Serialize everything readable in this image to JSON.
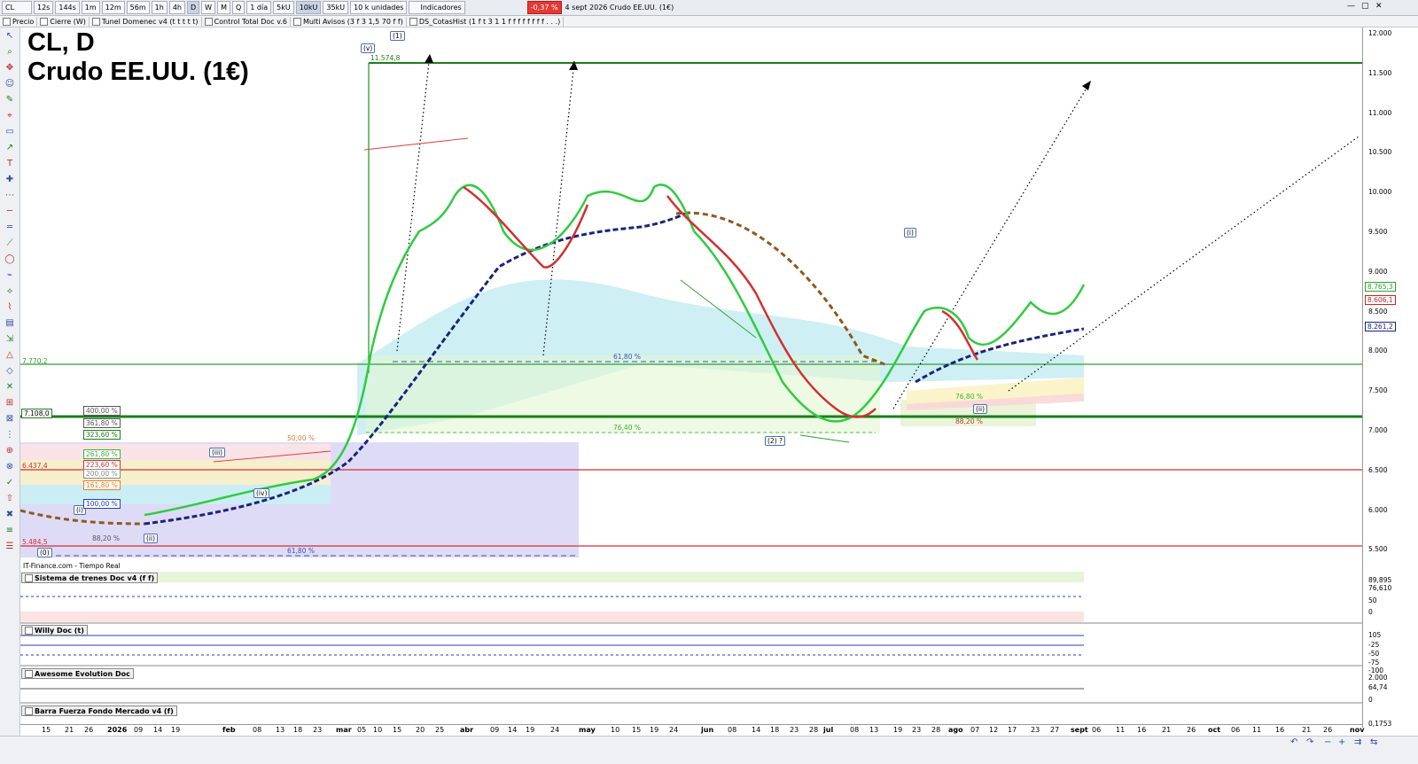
{
  "toolbar": {
    "symbol": "CL",
    "timeframes": [
      "12s",
      "144s",
      "1m",
      "12m",
      "56m",
      "1h",
      "4h",
      "D",
      "W",
      "M",
      "Q"
    ],
    "period": "1 día",
    "ticks": [
      "5kU",
      "10kU",
      "35kU"
    ],
    "units": "10 k unidades",
    "indicators": "Indicadores",
    "change": "-0,37 %",
    "status": "4 sept 2026  Crudo EE.UU. (1€)"
  },
  "toolbar2": {
    "items": [
      "Precio",
      "Cierre (W)",
      "Tunel Domenec v4 (t t t t t)",
      "Control Total Doc v.6",
      "Multi Avisos (3 f 3 1,5 70 f f)",
      "DS_CotasHist (1 f t 3 1 1 f f f f f f f f . . .)"
    ]
  },
  "chart": {
    "title_line1": "CL, D",
    "title_line2": "Crudo EE.UU. (1€)",
    "footer_label": "IT-Finance.com - Tiempo Real",
    "labels": {
      "top_price": "11.574,8",
      "fib_6180_a": "61,80 %",
      "fib_7640": "76,40 %",
      "fib_6180_b": "61,80 %",
      "fib_7680": "76,80 %",
      "fib_8820_a": "88,20 %",
      "fib_8820_b": "88,20 %",
      "fib_5000": "50,00 %",
      "level_7770": "7.770,2",
      "level_7108": "7.108,0",
      "level_6437": "6.437,4",
      "level_5484": "5.484,5",
      "wave_v": "(v)",
      "wave_1": "(1)",
      "wave_iii": "(iii)",
      "wave_iv": "(iv)",
      "wave_i": "(i)",
      "wave_ii": "(ii)",
      "wave_0": "(0)",
      "wave_2": "(2) ?",
      "wave_i2": "(i)",
      "wave_ii2": "(ii)"
    },
    "fib_boxes": [
      {
        "text": "400,00 %",
        "color": "#555555"
      },
      {
        "text": "361,80 %",
        "color": "#555555"
      },
      {
        "text": "323,60 %",
        "color": "#1b7e1b"
      },
      {
        "text": "261,80 %",
        "color": "#3cae3c"
      },
      {
        "text": "223,60 %",
        "color": "#d32f2f"
      },
      {
        "text": "200,00 %",
        "color": "#888888"
      },
      {
        "text": "161,80 %",
        "color": "#e67e22"
      },
      {
        "text": "100,00 %",
        "color": "#1f3fbf"
      }
    ]
  },
  "price_axis": {
    "ticks": [
      "12.000",
      "11.500",
      "11.000",
      "10.500",
      "10.000",
      "9.500",
      "9.000",
      "8.500",
      "8.000",
      "7.500",
      "7.000",
      "6.500",
      "6.000",
      "5.500"
    ],
    "badges": [
      {
        "text": "8.765,3",
        "color": "#2e9e2e"
      },
      {
        "text": "8.606,1",
        "color": "#c62828"
      },
      {
        "text": "8.261,2",
        "color": "#1a237e"
      }
    ]
  },
  "panels": [
    {
      "name": "Sistema de trenes Doc v4 (f f)",
      "right": [
        "89,895",
        "76,610",
        "50",
        "0"
      ]
    },
    {
      "name": "Willy Doc (t)",
      "right": [
        "105",
        "-25",
        "-50",
        "-75",
        "-100"
      ]
    },
    {
      "name": "Awesome Evolution Doc",
      "right": [
        "2.000",
        "64,74",
        "0"
      ]
    },
    {
      "name": "Barra Fuerza Fondo Mercado v4 (f)",
      "right": [
        "0,1753"
      ]
    }
  ],
  "x_axis": {
    "labels": [
      "15",
      "21",
      "26",
      "2026",
      "09",
      "14",
      "19",
      "feb",
      "08",
      "13",
      "18",
      "23",
      "mar",
      "05",
      "10",
      "15",
      "20",
      "25",
      "abr",
      "09",
      "14",
      "19",
      "24",
      "may",
      "10",
      "15",
      "19",
      "24",
      "jun",
      "08",
      "14",
      "18",
      "23",
      "28",
      "jul",
      "08",
      "13",
      "19",
      "23",
      "28",
      "ago",
      "07",
      "12",
      "17",
      "23",
      "27",
      "sept",
      "06",
      "11",
      "16",
      "21",
      "26",
      "oct",
      "06",
      "11",
      "16",
      "21",
      "26",
      "nov"
    ]
  },
  "colors": {
    "green_line": "#1d8a1d",
    "red_line": "#e53935",
    "navy": "#1a237e"
  }
}
